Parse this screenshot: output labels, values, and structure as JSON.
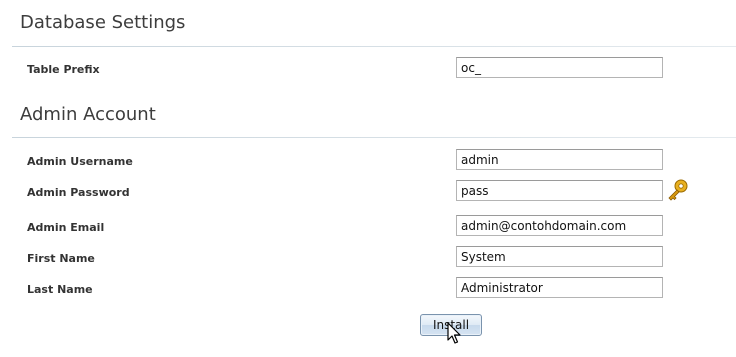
{
  "database": {
    "title": "Database Settings",
    "table_prefix": {
      "label": "Table Prefix",
      "value": "oc_"
    }
  },
  "admin": {
    "title": "Admin Account",
    "username": {
      "label": "Admin Username",
      "value": "admin"
    },
    "password": {
      "label": "Admin Password",
      "value": "pass"
    },
    "email": {
      "label": "Admin Email",
      "value": "admin@contohdomain.com"
    },
    "first_name": {
      "label": "First Name",
      "value": "System"
    },
    "last_name": {
      "label": "Last Name",
      "value": "Administrator"
    }
  },
  "actions": {
    "install_label": "Install"
  },
  "icons": {
    "password_generator": "key-icon",
    "pointer": "mouse-cursor-icon"
  }
}
